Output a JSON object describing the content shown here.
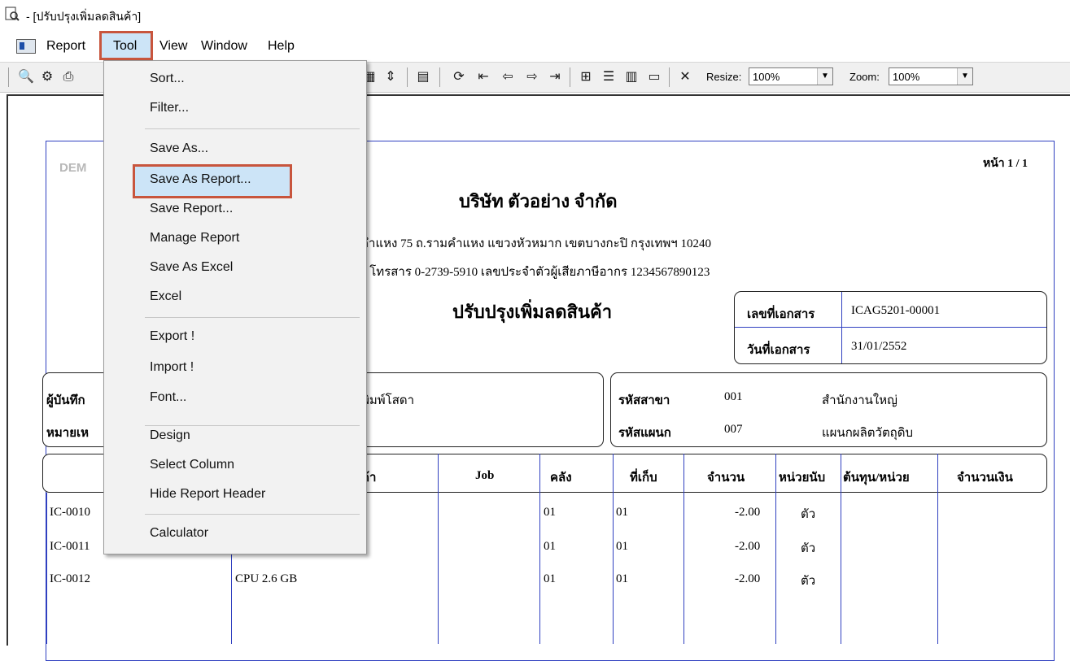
{
  "window": {
    "title": "- [ปรับปรุงเพิ่มลดสินค้า]"
  },
  "menubar": {
    "items": [
      "Report",
      "Tool",
      "View",
      "Window",
      "Help"
    ],
    "active": "Tool"
  },
  "toolbar": {
    "resize_label": "Resize:",
    "resize_value": "100%",
    "zoom_label": "Zoom:",
    "zoom_value": "100%"
  },
  "dropdown": {
    "items": [
      "Sort...",
      "Filter...",
      "Save As...",
      "Save As Report...",
      "Save Report...",
      "Manage Report",
      "Save As Excel",
      "Excel",
      "Export !",
      "Import !",
      "Font...",
      "Design",
      "Select Column",
      "Hide Report Header",
      "Calculator"
    ],
    "highlighted": "Save As Report..."
  },
  "report": {
    "watermark": "DEM",
    "page": "หน้า 1 / 1",
    "company": "บริษัท ตัวอย่าง จำกัด",
    "address": "คำแหง 75 ถ.รามคำแหง แขวงหัวหมาก เขตบางกะปิ กรุงเทพฯ 10240",
    "contact": "0  โทรสาร 0-2739-5910  เลขประจำตัวผู้เสียภาษีอากร 1234567890123",
    "title": "ปรับปรุงเพิ่มลดสินค้า",
    "doc_no_label": "เลขที่เอกสาร",
    "doc_no": "ICAG5201-00001",
    "doc_date_label": "วันที่เอกสาร",
    "doc_date": "31/01/2552",
    "recorder_label": "ผู้บันทึก",
    "recorder_value": "พิมพ์โสดา",
    "remark_label": "หมายเห",
    "branch_label": "รหัสสาขา",
    "branch_code": "001",
    "branch_name": "สำนักงานใหญ่",
    "dept_label": "รหัสแผนก",
    "dept_code": "007",
    "dept_name": "แผนกผลิตวัตถุดิบ",
    "columns": [
      "ค้า",
      "Job",
      "คลัง",
      "ที่เก็บ",
      "จำนวน",
      "หน่วยนับ",
      "ต้นทุน/หน่วย",
      "จำนวนเงิน"
    ],
    "rows": [
      {
        "code": "IC-0010",
        "name": "",
        "wh": "01",
        "loc": "01",
        "qty": "-2.00",
        "unit": "ตัว"
      },
      {
        "code": "IC-0011",
        "name": "",
        "wh": "01",
        "loc": "01",
        "qty": "-2.00",
        "unit": "ตัว"
      },
      {
        "code": "IC-0012",
        "name": "CPU  2.6 GB",
        "wh": "01",
        "loc": "01",
        "qty": "-2.00",
        "unit": "ตัว"
      }
    ]
  }
}
